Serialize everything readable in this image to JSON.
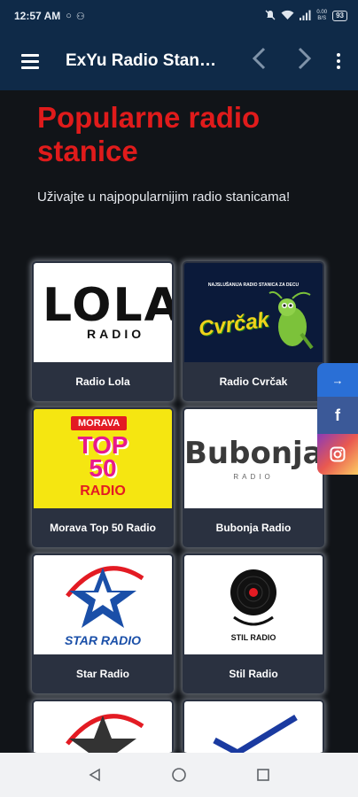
{
  "status_bar": {
    "time": "12:57 AM",
    "left_icons": [
      "circle-icon",
      "person-icon"
    ],
    "right_icons": [
      "mute-icon",
      "wifi-icon",
      "signal-icon"
    ],
    "net_speed_top": "0.00",
    "net_speed_bottom": "B/S",
    "battery": "93"
  },
  "app_bar": {
    "title": "ExYu Radio Stan…",
    "back_icon": "chevron-left-icon",
    "forward_icon": "chevron-right-icon",
    "more_icon": "more-vertical-icon"
  },
  "main": {
    "heading": "Popularne radio stanice",
    "subtitle": "Uživajte u najpopularnijim radio stanicama!"
  },
  "stations": [
    {
      "label": "Radio Lola",
      "logo_text": "LOLA",
      "logo_sub": "RADIO"
    },
    {
      "label": "Radio Cvrčak",
      "logo_text": "Cvrčak",
      "logo_sub": "NAJSLUŠANIJA RADIO STANICA ZA DECU"
    },
    {
      "label": "Morava Top 50 Radio",
      "logo_badge": "MORAVA",
      "logo_text": "TOP 50",
      "logo_sub": "RADIO"
    },
    {
      "label": "Bubonja Radio",
      "logo_text": "Bubonja",
      "logo_sub": "RADIO"
    },
    {
      "label": "Star Radio",
      "logo_text": "STAR RADIO"
    },
    {
      "label": "Stil Radio",
      "logo_text": "STIL RADIO"
    }
  ],
  "social": {
    "share_icon": "arrow-right-icon",
    "facebook_icon": "facebook-icon",
    "instagram_icon": "instagram-icon",
    "share_glyph": "→",
    "facebook_glyph": "f"
  },
  "nav_bar": {
    "back_icon": "triangle-back-icon",
    "home_icon": "circle-home-icon",
    "recents_icon": "square-recents-icon"
  },
  "colors": {
    "app_bar": "#0f2a48",
    "background": "#111418",
    "heading": "#e01b1b",
    "card": "#2a3140"
  }
}
